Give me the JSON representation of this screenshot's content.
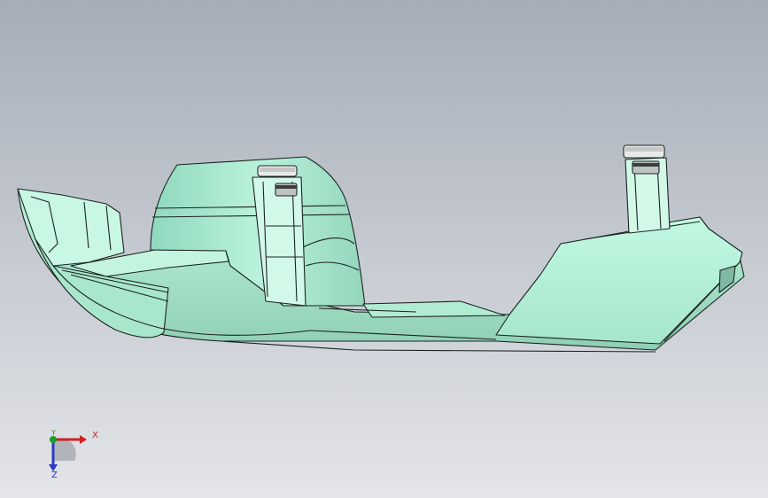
{
  "viewport": {
    "background_top": "#a6adb8",
    "background_bottom": "#e3e5e8",
    "part_color": "#b8f0d8",
    "edge_color": "#1b2420"
  },
  "triad": {
    "x_label": "X",
    "y_label": "Y",
    "z_label": "Z",
    "x_color": "#d12020",
    "y_color": "#1f9c2e",
    "z_color": "#2a39c8"
  }
}
